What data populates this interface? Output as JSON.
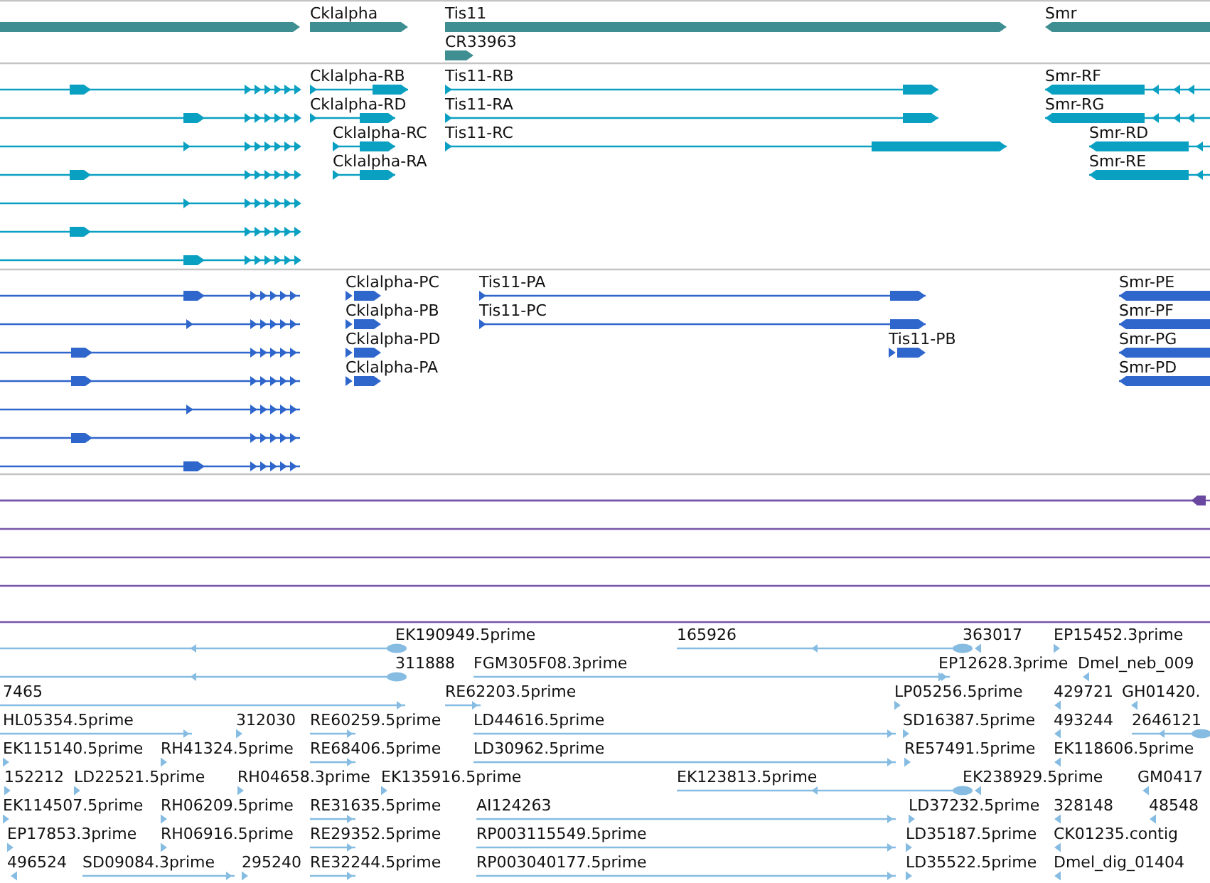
{
  "tracks": [
    {
      "kind": "gene",
      "features": [
        {
          "label": "Cklalpha",
          "reverse": false
        },
        {
          "label": "Tis11",
          "reverse": false
        },
        {
          "label": "CR33963",
          "reverse": false
        },
        {
          "label": "Smr",
          "reverse": true
        }
      ]
    },
    {
      "kind": "transcript",
      "features": [
        {
          "label": "Cklalpha-RB",
          "reverse": false
        },
        {
          "label": "Cklalpha-RD",
          "reverse": false
        },
        {
          "label": "Cklalpha-RC",
          "reverse": false
        },
        {
          "label": "Cklalpha-RA",
          "reverse": false
        },
        {
          "label": "Tis11-RB",
          "reverse": false
        },
        {
          "label": "Tis11-RA",
          "reverse": false
        },
        {
          "label": "Tis11-RC",
          "reverse": false
        },
        {
          "label": "Smr-RF",
          "reverse": true
        },
        {
          "label": "Smr-RG",
          "reverse": true
        },
        {
          "label": "Smr-RD",
          "reverse": true
        },
        {
          "label": "Smr-RE",
          "reverse": true
        }
      ]
    },
    {
      "kind": "protein",
      "features": [
        {
          "label": "Cklalpha-PC",
          "reverse": false
        },
        {
          "label": "Cklalpha-PB",
          "reverse": false
        },
        {
          "label": "Cklalpha-PD",
          "reverse": false
        },
        {
          "label": "Cklalpha-PA",
          "reverse": false
        },
        {
          "label": "Tis11-PA",
          "reverse": false
        },
        {
          "label": "Tis11-PC",
          "reverse": false
        },
        {
          "label": "Tis11-PB",
          "reverse": false
        },
        {
          "label": "Smr-PE",
          "reverse": true
        },
        {
          "label": "Smr-PF",
          "reverse": true
        },
        {
          "label": "Smr-PG",
          "reverse": true
        },
        {
          "label": "Smr-PD",
          "reverse": true
        }
      ]
    },
    {
      "kind": "plain"
    },
    {
      "kind": "est",
      "features": [
        {
          "label": "EK190949.5prime",
          "reverse": true
        },
        {
          "label": "165926",
          "reverse": true
        },
        {
          "label": "363017",
          "reverse": true
        },
        {
          "label": "EP15452.3prime",
          "reverse": false
        },
        {
          "label": "311888",
          "reverse": true
        },
        {
          "label": "FGM305F08.3prime",
          "reverse": false
        },
        {
          "label": "EP12628.3prime",
          "reverse": false
        },
        {
          "label": "Dmel_neb_009",
          "reverse": true
        },
        {
          "label": "7465",
          "reverse": false
        },
        {
          "label": "RE62203.5prime",
          "reverse": false
        },
        {
          "label": "LP05256.5prime",
          "reverse": false
        },
        {
          "label": "429721",
          "reverse": true
        },
        {
          "label": "GH01420.",
          "reverse": true
        },
        {
          "label": "HL05354.5prime",
          "reverse": false
        },
        {
          "label": "312030",
          "reverse": false
        },
        {
          "label": "RE60259.5prime",
          "reverse": false
        },
        {
          "label": "LD44616.5prime",
          "reverse": false
        },
        {
          "label": "SD16387.5prime",
          "reverse": false
        },
        {
          "label": "493244",
          "reverse": true
        },
        {
          "label": "2646121",
          "reverse": true
        },
        {
          "label": "EK115140.5prime",
          "reverse": false
        },
        {
          "label": "RH41324.5prime",
          "reverse": false
        },
        {
          "label": "RE68406.5prime",
          "reverse": false
        },
        {
          "label": "LD30962.5prime",
          "reverse": false
        },
        {
          "label": "RE57491.5prime",
          "reverse": false
        },
        {
          "label": "EK118606.5prime",
          "reverse": true
        },
        {
          "label": "152212",
          "reverse": false
        },
        {
          "label": "LD22521.5prime",
          "reverse": false
        },
        {
          "label": "RH04658.3prime",
          "reverse": false
        },
        {
          "label": "EK135916.5prime",
          "reverse": false
        },
        {
          "label": "EK123813.5prime",
          "reverse": true
        },
        {
          "label": "EK238929.5prime",
          "reverse": true
        },
        {
          "label": "GM0417",
          "reverse": true
        },
        {
          "label": "EK114507.5prime",
          "reverse": false
        },
        {
          "label": "RH06209.5prime",
          "reverse": false
        },
        {
          "label": "RE31635.5prime",
          "reverse": false
        },
        {
          "label": "AI124263",
          "reverse": false
        },
        {
          "label": "LD37232.5prime",
          "reverse": false
        },
        {
          "label": "328148",
          "reverse": true
        },
        {
          "label": "48548",
          "reverse": true
        },
        {
          "label": "EP17853.3prime",
          "reverse": false
        },
        {
          "label": "RH06916.5prime",
          "reverse": false
        },
        {
          "label": "RE29352.5prime",
          "reverse": false
        },
        {
          "label": "RP003115549.5prime",
          "reverse": false
        },
        {
          "label": "LD35187.5prime",
          "reverse": false
        },
        {
          "label": "CK01235.contig",
          "reverse": true
        },
        {
          "label": "496524",
          "reverse": true
        },
        {
          "label": "SD09084.3prime",
          "reverse": false
        },
        {
          "label": "295240",
          "reverse": false
        },
        {
          "label": "RE32244.5prime",
          "reverse": false
        },
        {
          "label": "RP003040177.5prime",
          "reverse": false
        },
        {
          "label": "LD35522.5prime",
          "reverse": false
        },
        {
          "label": "Dmel_dig_01404",
          "reverse": true
        }
      ]
    }
  ]
}
